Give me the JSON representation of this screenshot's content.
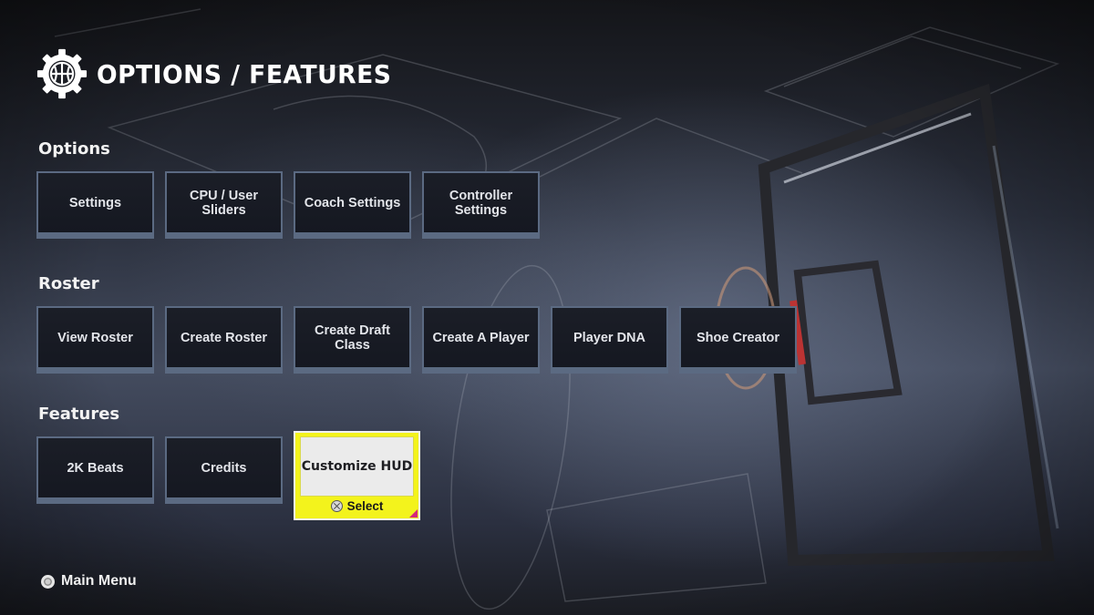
{
  "header": {
    "title": "OPTIONS / FEATURES",
    "icon": "gear-basketball-icon"
  },
  "sections": [
    {
      "label": "Options",
      "items": [
        {
          "label": "Settings"
        },
        {
          "label": "CPU / User Sliders"
        },
        {
          "label": "Coach Settings"
        },
        {
          "label": "Controller Settings"
        }
      ]
    },
    {
      "label": "Roster",
      "items": [
        {
          "label": "View Roster"
        },
        {
          "label": "Create Roster"
        },
        {
          "label": "Create Draft Class"
        },
        {
          "label": "Create A Player"
        },
        {
          "label": "Player DNA"
        },
        {
          "label": "Shoe Creator"
        }
      ]
    },
    {
      "label": "Features",
      "items": [
        {
          "label": "2K Beats"
        },
        {
          "label": "Credits"
        },
        {
          "label": "Customize HUD",
          "selected": true,
          "hint": "Select",
          "hint_icon": "cross-button-icon"
        }
      ]
    }
  ],
  "footer": {
    "back_label": "Main Menu",
    "back_icon": "circle-button-icon"
  },
  "colors": {
    "selected_tile": "#f3f31c",
    "selected_corner": "#d4287a",
    "tile_border": "#5b6a82",
    "tile_bg": "#181b24"
  }
}
